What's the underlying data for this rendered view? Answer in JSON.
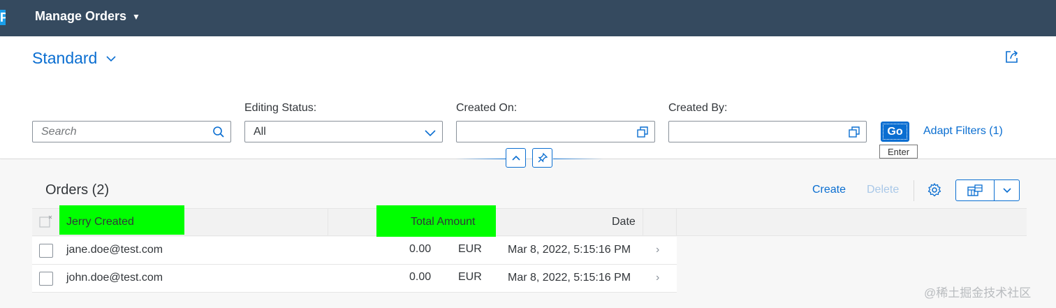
{
  "shell": {
    "logo_fragment": "P",
    "app_title": "Manage Orders",
    "caret": "▼"
  },
  "variant": {
    "name": "Standard"
  },
  "filters": {
    "search_placeholder": "Search",
    "editing_status_label": "Editing Status:",
    "editing_status_value": "All",
    "created_on_label": "Created On:",
    "created_on_value": "",
    "created_by_label": "Created By:",
    "created_by_value": "",
    "go_label": "Go",
    "go_tooltip": "Enter",
    "adapt_filters_label": "Adapt Filters (1)"
  },
  "table": {
    "title": "Orders (2)",
    "toolbar": {
      "create_label": "Create",
      "delete_label": "Delete"
    },
    "columns": [
      "Jerry Created",
      "Total Amount",
      "Date"
    ],
    "rows": [
      {
        "created_by": "jane.doe@test.com",
        "amount": "0.00",
        "currency": "EUR",
        "date": "Mar 8, 2022, 5:15:16 PM"
      },
      {
        "created_by": "john.doe@test.com",
        "amount": "0.00",
        "currency": "EUR",
        "date": "Mar 8, 2022, 5:15:16 PM"
      }
    ],
    "highlight_color": "#00ff00"
  },
  "watermark": "@稀土掘金技术社区",
  "colors": {
    "shell_bg": "#354a5f",
    "accent": "#0a6ed1",
    "content_bg": "#f7f7f7"
  },
  "icons": [
    "search-icon",
    "chevron-down-icon",
    "value-help-icon",
    "share-icon",
    "collapse-up-icon",
    "pin-icon",
    "settings-gear-icon",
    "export-icon"
  ]
}
